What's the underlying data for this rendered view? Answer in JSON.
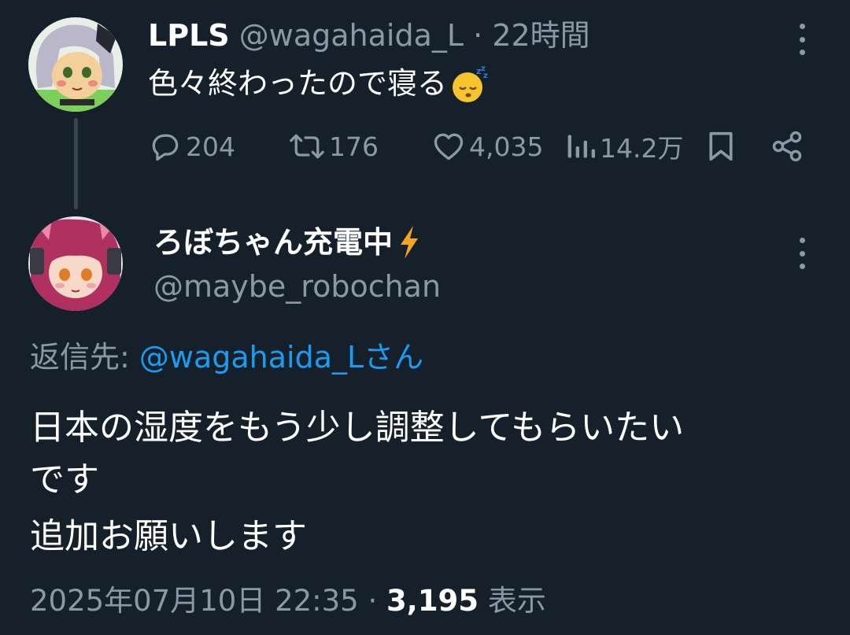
{
  "tweet1": {
    "author_name": "LPLS",
    "handle": "@wagahaida_L",
    "separator": "·",
    "time": "22時間",
    "text": "色々終わったので寝る",
    "emoji": "sleeping-face-emoji",
    "replies": "204",
    "retweets": "176",
    "likes": "4,035",
    "views": "14.2万"
  },
  "tweet2": {
    "author_name": "ろぼちゃん充電中",
    "name_emoji": "high-voltage-emoji",
    "handle": "@maybe_robochan",
    "reply_label": "返信先:",
    "reply_mention": "@wagahaida_Lさん",
    "text_lines": [
      "日本の湿度をもう少し調整してもらいたい",
      "です",
      "追加お願いします"
    ],
    "date": "2025年07月10日 22:35",
    "separator": "·",
    "views_count": "3,195",
    "views_label": "表示"
  },
  "colors": {
    "background": "#15202b",
    "text_primary": "#ffffff",
    "text_secondary": "#8b98a5",
    "link": "#1d9bf0",
    "thread_line": "#38444d"
  }
}
